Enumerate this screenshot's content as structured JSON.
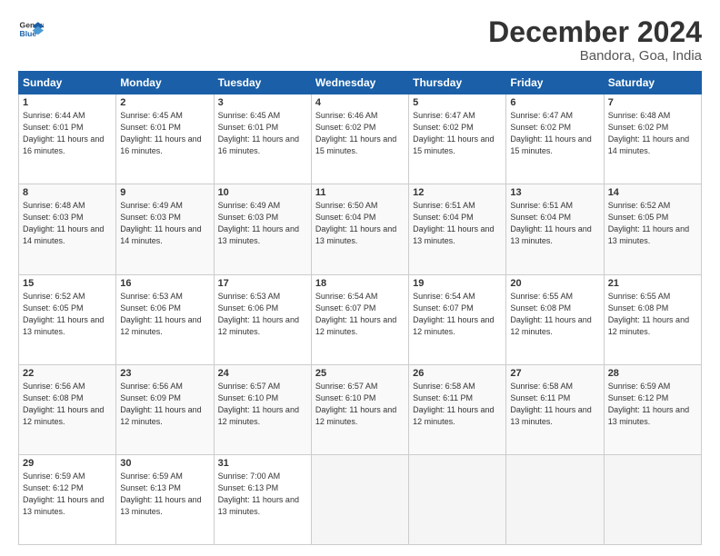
{
  "header": {
    "logo": "GeneralBlue",
    "month": "December 2024",
    "location": "Bandora, Goa, India"
  },
  "days_of_week": [
    "Sunday",
    "Monday",
    "Tuesday",
    "Wednesday",
    "Thursday",
    "Friday",
    "Saturday"
  ],
  "weeks": [
    [
      {
        "day": "1",
        "sunrise": "6:44 AM",
        "sunset": "6:01 PM",
        "daylight": "11 hours and 16 minutes."
      },
      {
        "day": "2",
        "sunrise": "6:45 AM",
        "sunset": "6:01 PM",
        "daylight": "11 hours and 16 minutes."
      },
      {
        "day": "3",
        "sunrise": "6:45 AM",
        "sunset": "6:01 PM",
        "daylight": "11 hours and 16 minutes."
      },
      {
        "day": "4",
        "sunrise": "6:46 AM",
        "sunset": "6:02 PM",
        "daylight": "11 hours and 15 minutes."
      },
      {
        "day": "5",
        "sunrise": "6:47 AM",
        "sunset": "6:02 PM",
        "daylight": "11 hours and 15 minutes."
      },
      {
        "day": "6",
        "sunrise": "6:47 AM",
        "sunset": "6:02 PM",
        "daylight": "11 hours and 15 minutes."
      },
      {
        "day": "7",
        "sunrise": "6:48 AM",
        "sunset": "6:02 PM",
        "daylight": "11 hours and 14 minutes."
      }
    ],
    [
      {
        "day": "8",
        "sunrise": "6:48 AM",
        "sunset": "6:03 PM",
        "daylight": "11 hours and 14 minutes."
      },
      {
        "day": "9",
        "sunrise": "6:49 AM",
        "sunset": "6:03 PM",
        "daylight": "11 hours and 14 minutes."
      },
      {
        "day": "10",
        "sunrise": "6:49 AM",
        "sunset": "6:03 PM",
        "daylight": "11 hours and 13 minutes."
      },
      {
        "day": "11",
        "sunrise": "6:50 AM",
        "sunset": "6:04 PM",
        "daylight": "11 hours and 13 minutes."
      },
      {
        "day": "12",
        "sunrise": "6:51 AM",
        "sunset": "6:04 PM",
        "daylight": "11 hours and 13 minutes."
      },
      {
        "day": "13",
        "sunrise": "6:51 AM",
        "sunset": "6:04 PM",
        "daylight": "11 hours and 13 minutes."
      },
      {
        "day": "14",
        "sunrise": "6:52 AM",
        "sunset": "6:05 PM",
        "daylight": "11 hours and 13 minutes."
      }
    ],
    [
      {
        "day": "15",
        "sunrise": "6:52 AM",
        "sunset": "6:05 PM",
        "daylight": "11 hours and 13 minutes."
      },
      {
        "day": "16",
        "sunrise": "6:53 AM",
        "sunset": "6:06 PM",
        "daylight": "11 hours and 12 minutes."
      },
      {
        "day": "17",
        "sunrise": "6:53 AM",
        "sunset": "6:06 PM",
        "daylight": "11 hours and 12 minutes."
      },
      {
        "day": "18",
        "sunrise": "6:54 AM",
        "sunset": "6:07 PM",
        "daylight": "11 hours and 12 minutes."
      },
      {
        "day": "19",
        "sunrise": "6:54 AM",
        "sunset": "6:07 PM",
        "daylight": "11 hours and 12 minutes."
      },
      {
        "day": "20",
        "sunrise": "6:55 AM",
        "sunset": "6:08 PM",
        "daylight": "11 hours and 12 minutes."
      },
      {
        "day": "21",
        "sunrise": "6:55 AM",
        "sunset": "6:08 PM",
        "daylight": "11 hours and 12 minutes."
      }
    ],
    [
      {
        "day": "22",
        "sunrise": "6:56 AM",
        "sunset": "6:08 PM",
        "daylight": "11 hours and 12 minutes."
      },
      {
        "day": "23",
        "sunrise": "6:56 AM",
        "sunset": "6:09 PM",
        "daylight": "11 hours and 12 minutes."
      },
      {
        "day": "24",
        "sunrise": "6:57 AM",
        "sunset": "6:10 PM",
        "daylight": "11 hours and 12 minutes."
      },
      {
        "day": "25",
        "sunrise": "6:57 AM",
        "sunset": "6:10 PM",
        "daylight": "11 hours and 12 minutes."
      },
      {
        "day": "26",
        "sunrise": "6:58 AM",
        "sunset": "6:11 PM",
        "daylight": "11 hours and 12 minutes."
      },
      {
        "day": "27",
        "sunrise": "6:58 AM",
        "sunset": "6:11 PM",
        "daylight": "11 hours and 13 minutes."
      },
      {
        "day": "28",
        "sunrise": "6:59 AM",
        "sunset": "6:12 PM",
        "daylight": "11 hours and 13 minutes."
      }
    ],
    [
      {
        "day": "29",
        "sunrise": "6:59 AM",
        "sunset": "6:12 PM",
        "daylight": "11 hours and 13 minutes."
      },
      {
        "day": "30",
        "sunrise": "6:59 AM",
        "sunset": "6:13 PM",
        "daylight": "11 hours and 13 minutes."
      },
      {
        "day": "31",
        "sunrise": "7:00 AM",
        "sunset": "6:13 PM",
        "daylight": "11 hours and 13 minutes."
      },
      null,
      null,
      null,
      null
    ]
  ]
}
